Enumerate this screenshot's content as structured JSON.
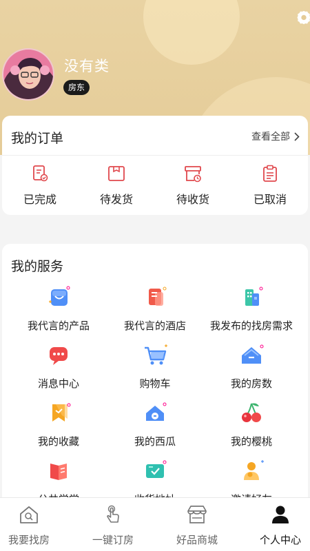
{
  "profile": {
    "name": "没有类",
    "role": "房东"
  },
  "orders": {
    "title": "我的订单",
    "view_all": "查看全部",
    "items": [
      {
        "label": "已完成",
        "icon": "order-completed-icon"
      },
      {
        "label": "待发货",
        "icon": "pending-shipment-icon"
      },
      {
        "label": "待收货",
        "icon": "pending-receipt-icon"
      },
      {
        "label": "已取消",
        "icon": "order-cancelled-icon"
      }
    ]
  },
  "services": {
    "title": "我的服务",
    "items": [
      {
        "label": "我代言的产品",
        "icon": "shopping-bag-icon"
      },
      {
        "label": "我代言的酒店",
        "icon": "hotel-document-icon"
      },
      {
        "label": "我发布的找房需求",
        "icon": "building-icon"
      },
      {
        "label": "消息中心",
        "icon": "message-icon"
      },
      {
        "label": "购物车",
        "icon": "shopping-cart-icon"
      },
      {
        "label": "我的房数",
        "icon": "house-icon"
      },
      {
        "label": "我的收藏",
        "icon": "bookmark-icon"
      },
      {
        "label": "我的西瓜",
        "icon": "house-coin-icon"
      },
      {
        "label": "我的樱桃",
        "icon": "cherry-icon"
      },
      {
        "label": "公共学堂",
        "icon": "book-icon"
      },
      {
        "label": "收货地址",
        "icon": "address-icon"
      },
      {
        "label": "邀请好友",
        "icon": "invite-friends-icon"
      }
    ]
  },
  "tabbar": {
    "items": [
      {
        "label": "我要找房",
        "icon": "house-search-icon",
        "active": false
      },
      {
        "label": "一键订房",
        "icon": "tap-hand-icon",
        "active": false
      },
      {
        "label": "好品商城",
        "icon": "store-icon",
        "active": false
      },
      {
        "label": "个人中心",
        "icon": "person-icon",
        "active": true
      }
    ]
  },
  "colors": {
    "header": "#e7cf9d",
    "accent": "#e0474c",
    "card": "#ffffff",
    "active_tab": "#111111"
  }
}
